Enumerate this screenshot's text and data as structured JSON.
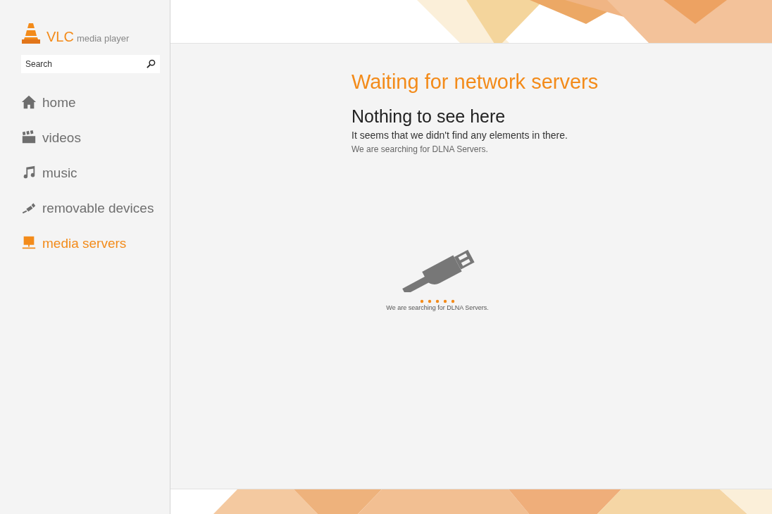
{
  "app": {
    "logo_title": "VLC",
    "logo_subtitle": "media player"
  },
  "search": {
    "placeholder": "Search"
  },
  "nav": [
    {
      "label": "home",
      "selected": false
    },
    {
      "label": "videos",
      "selected": false
    },
    {
      "label": "music",
      "selected": false
    },
    {
      "label": "removable devices",
      "selected": false
    },
    {
      "label": "media servers",
      "selected": true
    }
  ],
  "content": {
    "title": "Waiting for network servers",
    "heading": "Nothing to see here",
    "message": "It seems that we didn't find any elements in there.",
    "submessage": "We are searching for DLNA Servers.",
    "status": "We are searching for DLNA Servers."
  }
}
